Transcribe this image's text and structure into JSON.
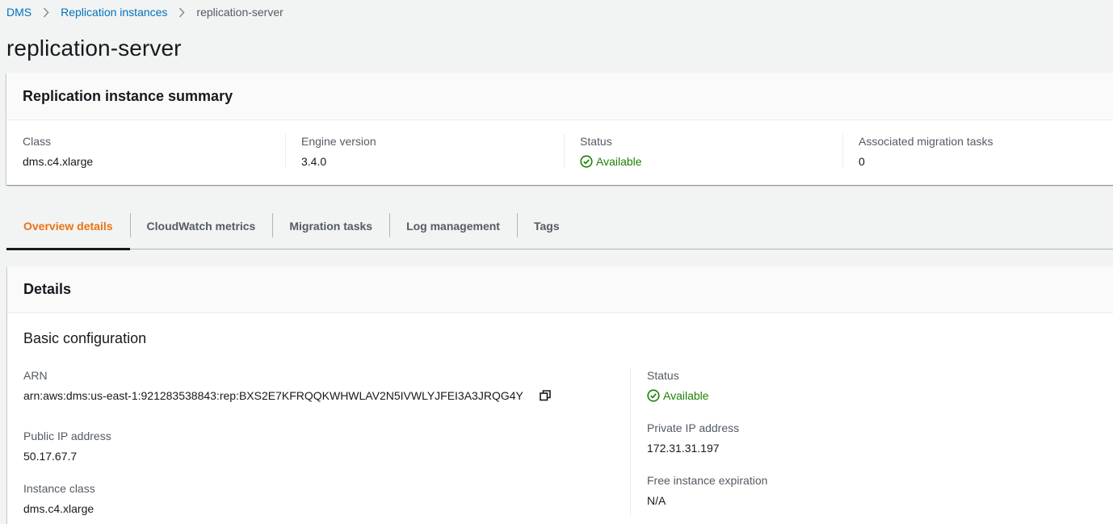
{
  "breadcrumb": {
    "items": [
      {
        "label": "DMS"
      },
      {
        "label": "Replication instances"
      },
      {
        "label": "replication-server"
      }
    ]
  },
  "page_title": "replication-server",
  "summary": {
    "title": "Replication instance summary",
    "columns": [
      {
        "label": "Class",
        "value": "dms.c4.xlarge"
      },
      {
        "label": "Engine version",
        "value": "3.4.0"
      },
      {
        "label": "Status",
        "value": "Available"
      },
      {
        "label": "Associated migration tasks",
        "value": "0"
      }
    ]
  },
  "tabs": [
    {
      "label": "Overview details",
      "active": true
    },
    {
      "label": "CloudWatch metrics"
    },
    {
      "label": "Migration tasks"
    },
    {
      "label": "Log management"
    },
    {
      "label": "Tags"
    }
  ],
  "details": {
    "title": "Details",
    "section_title": "Basic configuration",
    "arn": {
      "label": "ARN",
      "value": "arn:aws:dms:us-east-1:921283538843:rep:BXS2E7KFRQQKWHWLAV2N5IVWLYJFEI3A3JRQG4Y"
    },
    "public_ip": {
      "label": "Public IP address",
      "value": "50.17.67.7"
    },
    "instance_class": {
      "label": "Instance class",
      "value": "dms.c4.xlarge"
    },
    "status": {
      "label": "Status",
      "value": "Available"
    },
    "private_ip": {
      "label": "Private IP address",
      "value": "172.31.31.197"
    },
    "free_expiration": {
      "label": "Free instance expiration",
      "value": "N/A"
    }
  },
  "colors": {
    "link": "#0073bb",
    "active_tab": "#ec7211",
    "success": "#1d8102",
    "text": "#16191f",
    "muted": "#545b64"
  },
  "icons": {
    "breadcrumb_separator": "chevron-right-icon",
    "status": "check-circle-icon",
    "copy": "copy-icon"
  }
}
